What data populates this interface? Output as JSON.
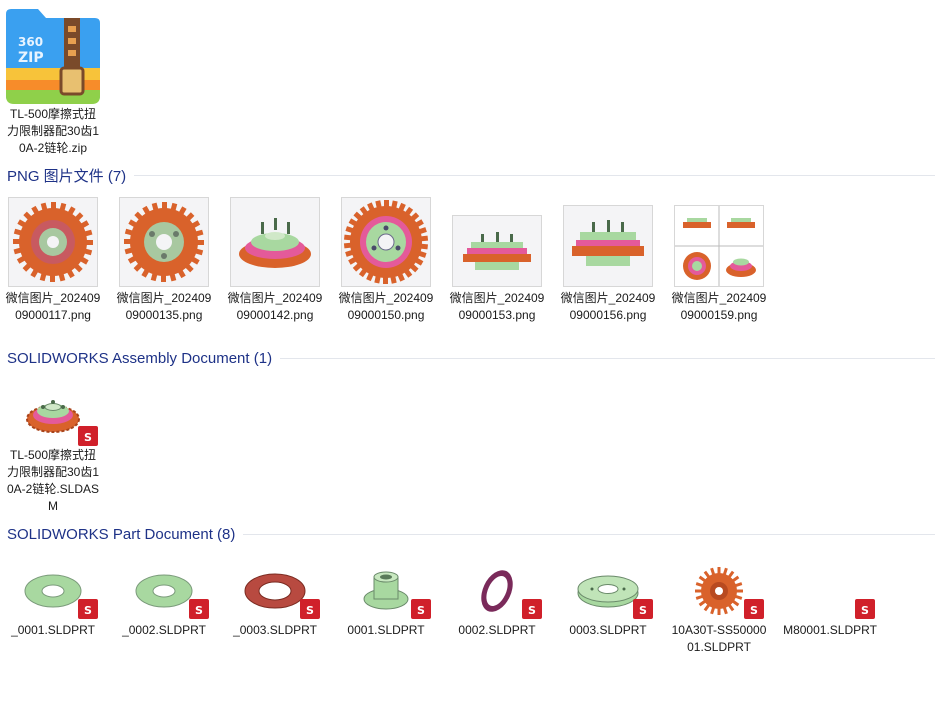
{
  "zip_file": {
    "label": "TL-500摩擦式扭力限制器配30齿10A-2链轮.zip",
    "icon_text": "360\nZIP"
  },
  "groups": [
    {
      "title": "PNG 图片文件 (7)"
    },
    {
      "title": "SOLIDWORKS Assembly Document (1)"
    },
    {
      "title": "SOLIDWORKS Part Document (8)"
    }
  ],
  "png_files": [
    {
      "label": "微信图片_20240909000117.png",
      "icon": "sprocket-render-1"
    },
    {
      "label": "微信图片_20240909000135.png",
      "icon": "sprocket-render-2"
    },
    {
      "label": "微信图片_20240909000142.png",
      "icon": "assembly-render-3"
    },
    {
      "label": "微信图片_20240909000150.png",
      "icon": "sprocket-top-view"
    },
    {
      "label": "微信图片_20240909000153.png",
      "icon": "assembly-side-view"
    },
    {
      "label": "微信图片_20240909000156.png",
      "icon": "assembly-side-view-2"
    },
    {
      "label": "微信图片_20240909000159.png",
      "icon": "four-view-render"
    }
  ],
  "assembly_files": [
    {
      "label": "TL-500摩擦式扭力限制器配30齿10A-2链轮.SLDASM",
      "icon": "assembly-icon"
    }
  ],
  "part_files": [
    {
      "label": "_0001.SLDPRT",
      "icon": "washer-green-icon"
    },
    {
      "label": "_0002.SLDPRT",
      "icon": "washer-green-icon"
    },
    {
      "label": "_0003.SLDPRT",
      "icon": "friction-plate-red-icon"
    },
    {
      "label": "0001.SLDPRT",
      "icon": "hub-icon"
    },
    {
      "label": "0002.SLDPRT",
      "icon": "ring-purple-icon"
    },
    {
      "label": "0003.SLDPRT",
      "icon": "plate-green-icon"
    },
    {
      "label": "10A30T-SS5000001.SLDPRT",
      "icon": "sprocket-icon"
    },
    {
      "label": "M80001.SLDPRT",
      "icon": "blank-part-icon"
    }
  ],
  "colors": {
    "group_title": "#1e3287",
    "sw_red": "#d0202a",
    "sprocket_orange": "#d9622b"
  }
}
